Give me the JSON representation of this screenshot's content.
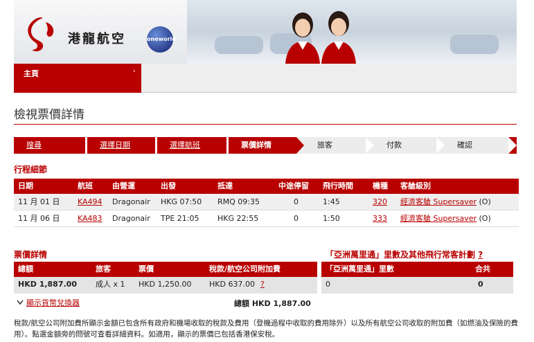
{
  "header": {
    "brand_name": "港龍航空",
    "alliance_badge": "oneworld"
  },
  "nav": {
    "home_label": "主頁",
    "home_arrow": "›"
  },
  "page_title": "檢視票價詳情",
  "steps": [
    {
      "label": "搜尋",
      "state": "done"
    },
    {
      "label": "選擇日期",
      "state": "done"
    },
    {
      "label": "選擇航班",
      "state": "done"
    },
    {
      "label": "票價詳情",
      "state": "current"
    },
    {
      "label": "旅客",
      "state": "todo"
    },
    {
      "label": "付款",
      "state": "todo"
    },
    {
      "label": "確認",
      "state": "todo"
    }
  ],
  "itinerary": {
    "title": "行程細節",
    "headers": [
      "日期",
      "航班",
      "由營運",
      "出發",
      "抵達",
      "中途停留",
      "飛行時間",
      "機種",
      "客艙級別"
    ],
    "rows": [
      {
        "date": "11 月 01 日",
        "flight": "KA494",
        "operator": "Dragonair",
        "depart": "HKG 07:50",
        "arrive": "RMQ 09:35",
        "stops": "0",
        "duration": "1:45",
        "aircraft": "320",
        "cabin_link": "經濟客艙 Supersaver",
        "cabin_code": " (O)"
      },
      {
        "date": "11 月 06 日",
        "flight": "KA483",
        "operator": "Dragonair",
        "depart": "TPE 21:05",
        "arrive": "HKG 22:55",
        "stops": "0",
        "duration": "1:50",
        "aircraft": "333",
        "cabin_link": "經濟客艙 Supersaver",
        "cabin_code": " (O)"
      }
    ]
  },
  "fare": {
    "title": "票價詳情",
    "headers": [
      "總額",
      "旅客",
      "票價",
      "稅款/航空公司附加費"
    ],
    "row": {
      "total": "HKD 1,887.00",
      "passenger": "成人 x 1",
      "fare": "HKD 1,250.00",
      "tax": "HKD 637.00",
      "tax_help": "?"
    },
    "converter_label": "顯示貨幣兌換器",
    "grand_total": "總額 HKD 1,887.00"
  },
  "miles": {
    "title": "「亞洲萬里通」里數及其他飛行常客計劃",
    "help": "?",
    "headers": [
      "「亞洲萬里通」里數",
      "合共"
    ],
    "row": {
      "miles": "0",
      "total": "0"
    }
  },
  "note": "稅款/航空公司附加費所顯示金額已包含所有政府和機場收取的稅款及費用（登機過程中收取的費用除外）以及所有航空公司收取的附加費（如燃油及保險的費用）。點選金額旁的問號可查看詳細資料。如適用，顯示的票價已包括香港保安稅。",
  "colors": {
    "brand_red": "#b80000",
    "row_alt": "#efefef"
  }
}
